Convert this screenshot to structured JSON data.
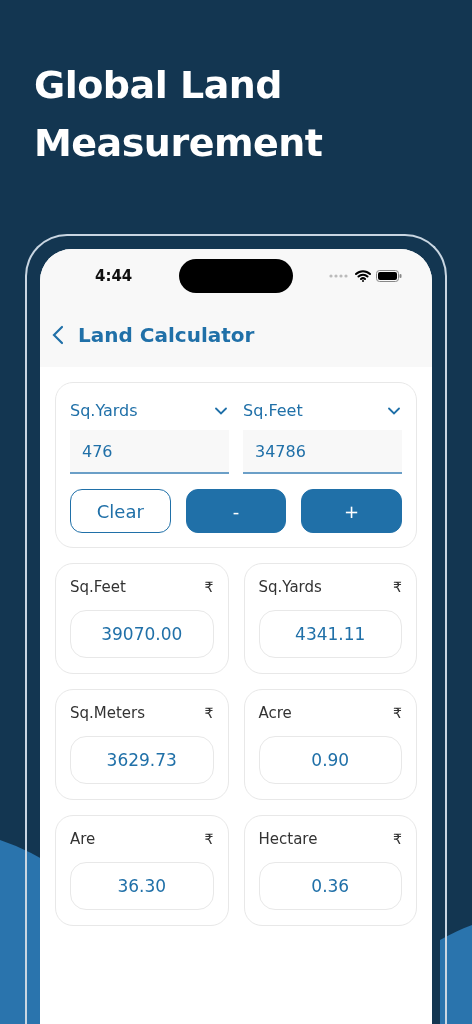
{
  "headline": "Global Land Measurement",
  "status_bar": {
    "time": "4:44"
  },
  "header": {
    "title": "Land Calculator"
  },
  "converter": {
    "units": [
      {
        "label": "Sq.Yards",
        "value": "476"
      },
      {
        "label": "Sq.Feet",
        "value": "34786"
      }
    ],
    "buttons": [
      {
        "label": "Clear",
        "kind": "outline"
      },
      {
        "label": "-",
        "kind": "filled"
      },
      {
        "label": "+",
        "kind": "filled"
      }
    ]
  },
  "results": [
    {
      "unit": "Sq.Feet",
      "currency": "₹",
      "value": "39070.00"
    },
    {
      "unit": "Sq.Yards",
      "currency": "₹",
      "value": "4341.11"
    },
    {
      "unit": "Sq.Meters",
      "currency": "₹",
      "value": "3629.73"
    },
    {
      "unit": "Acre",
      "currency": "₹",
      "value": "0.90"
    },
    {
      "unit": "Are",
      "currency": "₹",
      "value": "36.30"
    },
    {
      "unit": "Hectare",
      "currency": "₹",
      "value": "0.36"
    }
  ]
}
